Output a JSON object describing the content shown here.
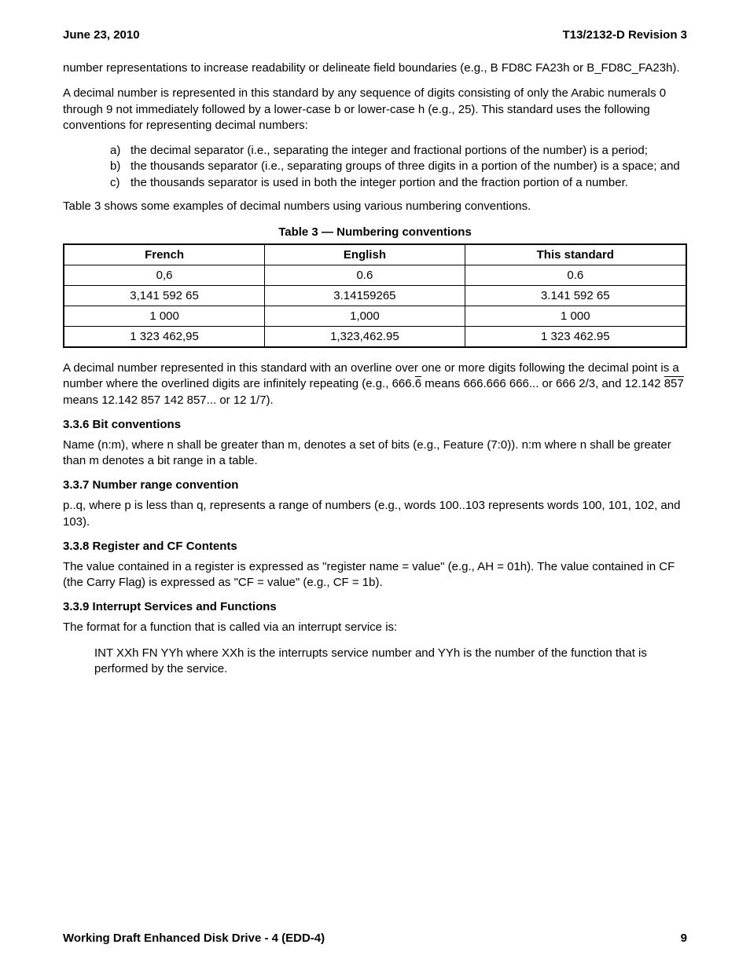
{
  "header": {
    "date": "June 23, 2010",
    "doc": "T13/2132-D Revision 3"
  },
  "intro": "number representations to increase readability or delineate field boundaries (e.g., B FD8C FA23h or B_FD8C_FA23h).",
  "dec_intro": "A decimal number is represented in this standard by any sequence of digits consisting of only the Arabic numerals 0 through 9 not immediately followed by a lower-case b or lower-case h (e.g., 25).  This standard uses the following conventions for representing decimal numbers:",
  "list": {
    "a": {
      "m": "a)",
      "t": "the decimal separator (i.e., separating the integer and fractional portions of the number) is a period;"
    },
    "b": {
      "m": "b)",
      "t": "the thousands separator (i.e., separating groups of three digits in a portion of the number) is a space; and"
    },
    "c": {
      "m": "c)",
      "t": "the thousands separator is used in both the integer portion and the fraction portion of a number."
    }
  },
  "table_lead": "Table 3 shows some examples of decimal numbers using various numbering conventions.",
  "table_caption": "Table 3 — Numbering conventions",
  "table": {
    "h1": "French",
    "h2": "English",
    "h3": "This standard",
    "r1": {
      "c1": "0,6",
      "c2": "0.6",
      "c3": "0.6"
    },
    "r2": {
      "c1": "3,141 592 65",
      "c2": "3.14159265",
      "c3": "3.141 592 65"
    },
    "r3": {
      "c1": "1 000",
      "c2": "1,000",
      "c3": "1 000"
    },
    "r4": {
      "c1": "1 323 462,95",
      "c2": "1,323,462.95",
      "c3": "1 323 462.95"
    }
  },
  "overline": {
    "pre": "A decimal number represented in this standard with an overline over one or more digits following the decimal point is a number where the overlined digits are infinitely repeating (e.g., 666.",
    "d1": "6",
    "mid1": " means 666.666 666...  or 666 2/3, and 12.142 ",
    "d2": "857",
    "post": " means 12.142 857 142 857...  or 12 1/7)."
  },
  "s336": {
    "h": "3.3.6 Bit conventions",
    "p": "Name (n:m), where n shall be greater than m, denotes a set of bits (e.g., Feature (7:0)).  n:m where n shall be greater than m denotes a bit range in a table."
  },
  "s337": {
    "h": "3.3.7 Number range convention",
    "p": "p..q, where p is less than q, represents a range of numbers (e.g., words 100..103 represents words 100, 101, 102, and 103)."
  },
  "s338": {
    "h": "3.3.8 Register and CF Contents",
    "p": "The value contained in a register is expressed as \"register name = value\" (e.g., AH = 01h).  The value contained in CF (the Carry Flag) is expressed as \"CF = value\" (e.g., CF = 1b)."
  },
  "s339": {
    "h": "3.3.9 Interrupt Services and Functions",
    "p": "The format for a function that is called via an interrupt service is:",
    "ind": "INT XXh FN YYh where XXh is the interrupts service number and YYh is the number of the function that is performed by the service."
  },
  "footer": {
    "title": "Working Draft Enhanced Disk Drive - 4  (EDD-4)",
    "page": "9"
  }
}
